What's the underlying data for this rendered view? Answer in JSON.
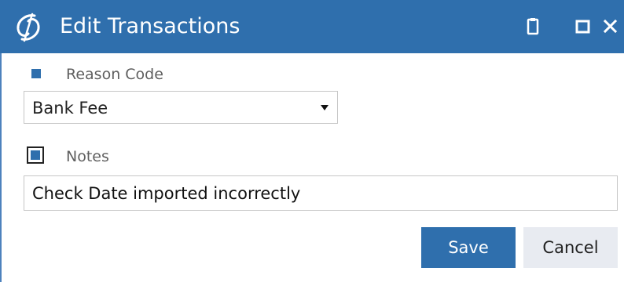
{
  "window": {
    "title": "Edit Transactions",
    "logo_icon": "swirl-logo-icon",
    "controls": [
      "clipboard-icon",
      "maximize-icon",
      "close-icon"
    ]
  },
  "form": {
    "reason_code": {
      "label": "Reason Code",
      "value": "Bank Fee",
      "checked": true
    },
    "notes": {
      "label": "Notes",
      "value": "Check Date imported incorrectly",
      "checked": true
    }
  },
  "actions": {
    "save_label": "Save",
    "cancel_label": "Cancel"
  },
  "colors": {
    "titlebar": "#2f6fad",
    "accent": "#2f6fad",
    "cancel_bg": "#e8ebf1"
  }
}
